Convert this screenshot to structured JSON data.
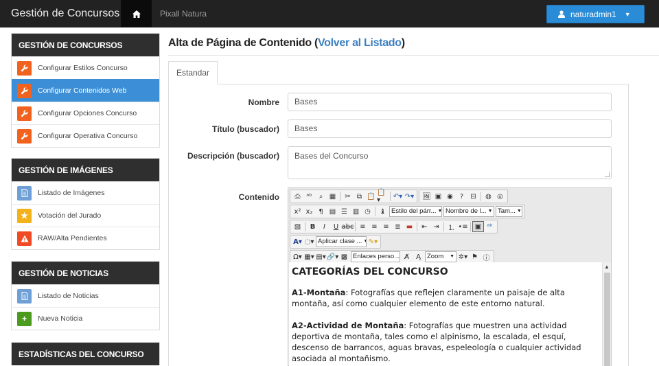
{
  "navbar": {
    "brand": "Gestión de Concursos",
    "home_icon": "home-icon",
    "site_name": "Pixall Natura",
    "user_name": "naturadmin1",
    "colors": {
      "bar": "#222222",
      "user_button": "#2a8bd6"
    }
  },
  "sidebar": {
    "contests": {
      "title": "GESTIÓN DE CONCURSOS",
      "items": [
        {
          "label": "Configurar Estilos Concurso",
          "icon": "wrench-icon"
        },
        {
          "label": "Configurar Contenidos Web",
          "icon": "wrench-icon",
          "active": true
        },
        {
          "label": "Configurar Opciones Concurso",
          "icon": "wrench-icon"
        },
        {
          "label": "Configurar Operativa Concurso",
          "icon": "wrench-icon"
        }
      ]
    },
    "images": {
      "title": "GESTIÓN DE IMÁGENES",
      "items": [
        {
          "label": "Listado de Imágenes",
          "icon": "document-icon"
        },
        {
          "label": "Votación del Jurado",
          "icon": "star-icon"
        },
        {
          "label": "RAW/Alta Pendientes",
          "icon": "warning-icon"
        }
      ]
    },
    "news": {
      "title": "GESTIÓN DE NOTICIAS",
      "items": [
        {
          "label": "Listado de Noticias",
          "icon": "document-icon"
        },
        {
          "label": "Nueva Noticia",
          "icon": "plus-icon"
        }
      ]
    },
    "stats": {
      "title": "ESTADÍSTICAS DEL CONCURSO"
    }
  },
  "main": {
    "title": "Alta de Página de Contenido",
    "title_open": " (",
    "back_link": "Volver al Listado",
    "title_close": ")",
    "tab": "Estandar",
    "form": {
      "name_label": "Nombre",
      "name_value": "Bases",
      "seo_title_label": "Título (buscador)",
      "seo_title_value": "Bases",
      "description_label": "Descripción (buscador)",
      "description_value": "Bases del Concurso",
      "content_label": "Contenido"
    },
    "editor": {
      "format_select": "Estilo del párr...",
      "font_select": "Nombre de l...",
      "size_select": "Tam...",
      "class_select": "Aplicar clase ...",
      "links_select": "Enlaces perso...",
      "zoom_select": "Zoom",
      "content": {
        "heading": "CATEGORÍAS DEL CONCURSO",
        "p1_bold": "A1-Montaña",
        "p1_text": ": Fotografías que reflejen claramente un paisaje de alta montaña, así como cualquier elemento de este entorno natural.",
        "p2_bold": "A2-Actividad de Montaña",
        "p2_text": ": Fotografías que muestren una actividad deportiva de montaña, tales como el alpinismo, la escalada, el esquí, descenso de barrancos, aguas bravas, espeleología o cualquier actividad asociada al montañismo."
      }
    }
  }
}
